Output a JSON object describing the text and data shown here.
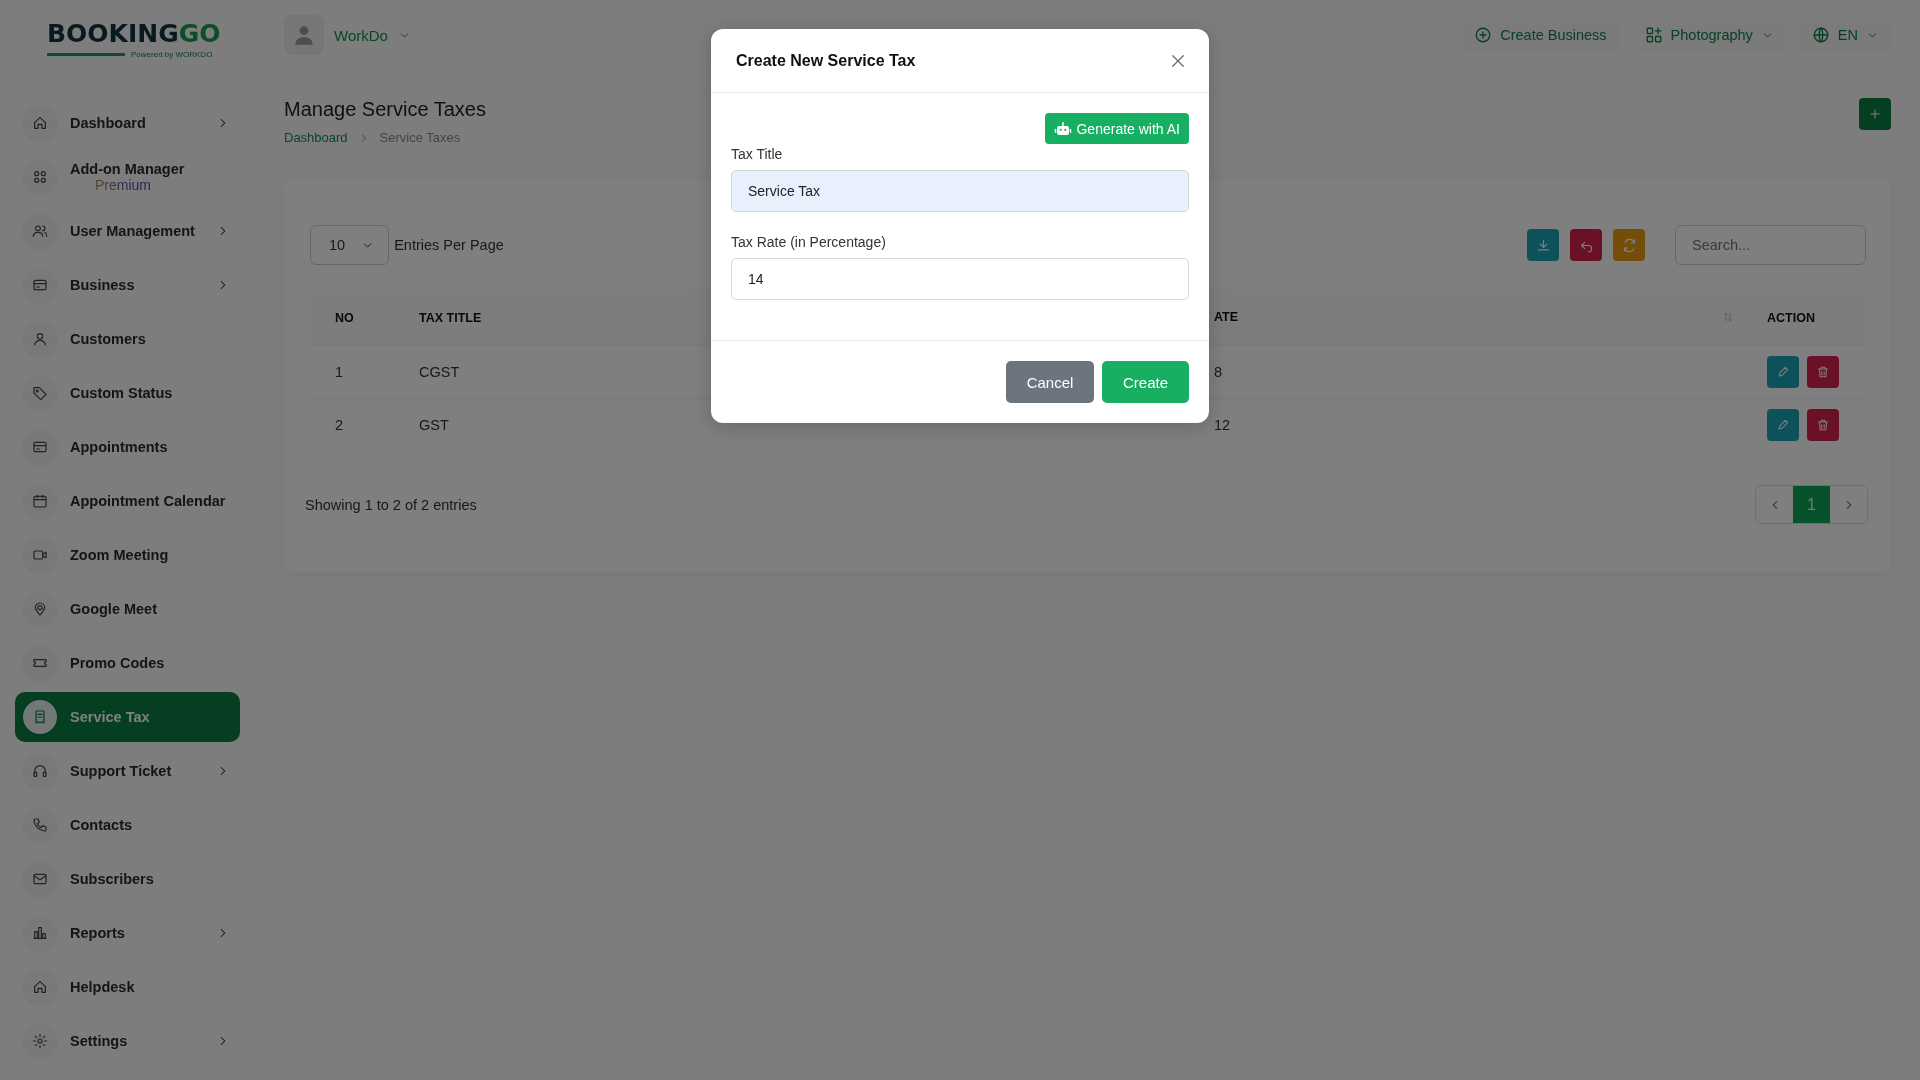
{
  "brand": {
    "logo_dark": "BOOKING",
    "logo_green": "GO",
    "tagline": "Powered by WORKDO"
  },
  "sidebar": {
    "items": [
      {
        "label": "Dashboard",
        "kind": "home",
        "chevron": true,
        "selected": false
      },
      {
        "label": "Add-on Manager",
        "sublabel": "Premium",
        "kind": "apps",
        "chevron": false,
        "selected": false
      },
      {
        "label": "User Management",
        "kind": "users",
        "chevron": true,
        "selected": false
      },
      {
        "label": "Business",
        "kind": "card",
        "chevron": true,
        "selected": false
      },
      {
        "label": "Customers",
        "kind": "user",
        "chevron": false,
        "selected": false
      },
      {
        "label": "Custom Status",
        "kind": "tag",
        "chevron": false,
        "selected": false
      },
      {
        "label": "Appointments",
        "kind": "card",
        "chevron": false,
        "selected": false
      },
      {
        "label": "Appointment Calendar",
        "kind": "calendar",
        "chevron": false,
        "selected": false
      },
      {
        "label": "Zoom Meeting",
        "kind": "video",
        "chevron": false,
        "selected": false
      },
      {
        "label": "Google Meet",
        "kind": "pin",
        "chevron": false,
        "selected": false
      },
      {
        "label": "Promo Codes",
        "kind": "ticket",
        "chevron": false,
        "selected": false
      },
      {
        "label": "Service Tax",
        "kind": "receipt",
        "chevron": false,
        "selected": true
      },
      {
        "label": "Support Ticket",
        "kind": "headset",
        "chevron": true,
        "selected": false
      },
      {
        "label": "Contacts",
        "kind": "phone",
        "chevron": false,
        "selected": false
      },
      {
        "label": "Subscribers",
        "kind": "mail",
        "chevron": false,
        "selected": false
      },
      {
        "label": "Reports",
        "kind": "chart",
        "chevron": true,
        "selected": false
      },
      {
        "label": "Helpdesk",
        "kind": "home",
        "chevron": false,
        "selected": false
      },
      {
        "label": "Settings",
        "kind": "gear",
        "chevron": true,
        "selected": false
      }
    ]
  },
  "topbar": {
    "workspace": "WorkDo",
    "actions": [
      {
        "label": "Create Business",
        "kind": "plus-circle",
        "dropdown": false
      },
      {
        "label": "Photography",
        "kind": "apps-plus",
        "dropdown": true
      },
      {
        "label": "EN",
        "kind": "globe",
        "dropdown": true
      }
    ]
  },
  "page": {
    "title": "Manage Service Taxes",
    "breadcrumbs": [
      {
        "label": "Dashboard",
        "link": true
      },
      {
        "label": "Service Taxes",
        "link": false
      }
    ]
  },
  "toolbar": {
    "entries": "10",
    "entries_label": "Entries Per Page",
    "tools": [
      {
        "kind": "download"
      },
      {
        "kind": "undo"
      },
      {
        "kind": "refresh"
      }
    ],
    "search": {
      "placeholder": "Search..."
    }
  },
  "table": {
    "columns": [
      {
        "label": "NO",
        "sortable": false
      },
      {
        "label": "TAX TITLE",
        "sortable": false
      },
      {
        "label": "ATE",
        "sortable": true
      },
      {
        "label": "ACTION",
        "sortable": false
      }
    ],
    "rows": [
      {
        "no": "1",
        "title": "CGST",
        "column_3": "8"
      },
      {
        "no": "2",
        "title": "GST",
        "column_3": "12"
      }
    ]
  },
  "footer": {
    "summary": "Showing 1 to 2 of 2 entries",
    "pages": [
      {
        "label": "1",
        "selected": true
      }
    ]
  },
  "modal": {
    "title": "Create New Service Tax",
    "ai_button": "Generate with AI",
    "fields": [
      {
        "label": "Tax Title",
        "value": "Service Tax",
        "autofilled": true
      },
      {
        "label": "Tax Rate (in Percentage)",
        "value": "14",
        "autofilled": false
      }
    ],
    "buttons": [
      {
        "label": "Cancel",
        "kind": "secondary"
      },
      {
        "label": "Create",
        "kind": "primary"
      }
    ]
  }
}
